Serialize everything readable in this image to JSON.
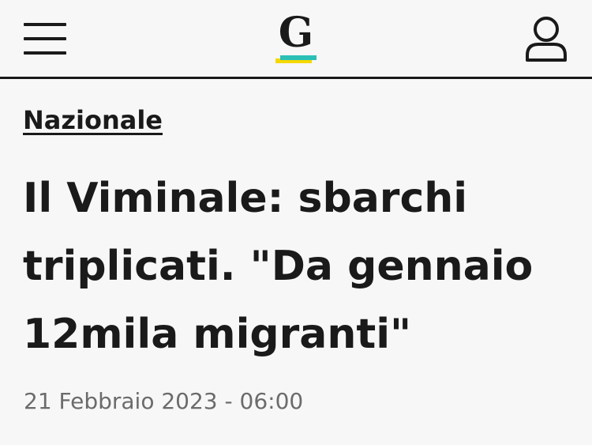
{
  "header": {
    "logo_letter": "G",
    "menu_icon": "hamburger-menu-icon",
    "user_icon": "user-account-icon",
    "brand_colors": {
      "yellow": "#f5d800",
      "teal": "#2bbfb5"
    }
  },
  "article": {
    "section": "Nazionale",
    "headline": "Il Viminale: sbarchi triplicati. \"Da gennaio 12mila migranti\"",
    "date": "21 Febbraio 2023 - 06:00"
  }
}
